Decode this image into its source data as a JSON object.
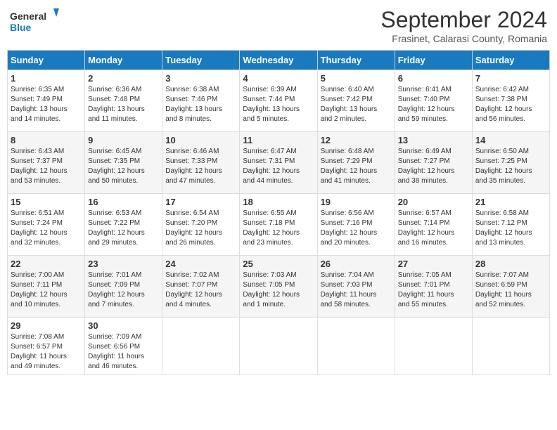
{
  "header": {
    "logo_line1": "General",
    "logo_line2": "Blue",
    "month": "September 2024",
    "location": "Frasinet, Calarasi County, Romania"
  },
  "days_of_week": [
    "Sunday",
    "Monday",
    "Tuesday",
    "Wednesday",
    "Thursday",
    "Friday",
    "Saturday"
  ],
  "weeks": [
    [
      {
        "day": "1",
        "lines": [
          "Sunrise: 6:35 AM",
          "Sunset: 7:49 PM",
          "Daylight: 13 hours",
          "and 14 minutes."
        ]
      },
      {
        "day": "2",
        "lines": [
          "Sunrise: 6:36 AM",
          "Sunset: 7:48 PM",
          "Daylight: 13 hours",
          "and 11 minutes."
        ]
      },
      {
        "day": "3",
        "lines": [
          "Sunrise: 6:38 AM",
          "Sunset: 7:46 PM",
          "Daylight: 13 hours",
          "and 8 minutes."
        ]
      },
      {
        "day": "4",
        "lines": [
          "Sunrise: 6:39 AM",
          "Sunset: 7:44 PM",
          "Daylight: 13 hours",
          "and 5 minutes."
        ]
      },
      {
        "day": "5",
        "lines": [
          "Sunrise: 6:40 AM",
          "Sunset: 7:42 PM",
          "Daylight: 13 hours",
          "and 2 minutes."
        ]
      },
      {
        "day": "6",
        "lines": [
          "Sunrise: 6:41 AM",
          "Sunset: 7:40 PM",
          "Daylight: 12 hours",
          "and 59 minutes."
        ]
      },
      {
        "day": "7",
        "lines": [
          "Sunrise: 6:42 AM",
          "Sunset: 7:38 PM",
          "Daylight: 12 hours",
          "and 56 minutes."
        ]
      }
    ],
    [
      {
        "day": "8",
        "lines": [
          "Sunrise: 6:43 AM",
          "Sunset: 7:37 PM",
          "Daylight: 12 hours",
          "and 53 minutes."
        ]
      },
      {
        "day": "9",
        "lines": [
          "Sunrise: 6:45 AM",
          "Sunset: 7:35 PM",
          "Daylight: 12 hours",
          "and 50 minutes."
        ]
      },
      {
        "day": "10",
        "lines": [
          "Sunrise: 6:46 AM",
          "Sunset: 7:33 PM",
          "Daylight: 12 hours",
          "and 47 minutes."
        ]
      },
      {
        "day": "11",
        "lines": [
          "Sunrise: 6:47 AM",
          "Sunset: 7:31 PM",
          "Daylight: 12 hours",
          "and 44 minutes."
        ]
      },
      {
        "day": "12",
        "lines": [
          "Sunrise: 6:48 AM",
          "Sunset: 7:29 PM",
          "Daylight: 12 hours",
          "and 41 minutes."
        ]
      },
      {
        "day": "13",
        "lines": [
          "Sunrise: 6:49 AM",
          "Sunset: 7:27 PM",
          "Daylight: 12 hours",
          "and 38 minutes."
        ]
      },
      {
        "day": "14",
        "lines": [
          "Sunrise: 6:50 AM",
          "Sunset: 7:25 PM",
          "Daylight: 12 hours",
          "and 35 minutes."
        ]
      }
    ],
    [
      {
        "day": "15",
        "lines": [
          "Sunrise: 6:51 AM",
          "Sunset: 7:24 PM",
          "Daylight: 12 hours",
          "and 32 minutes."
        ]
      },
      {
        "day": "16",
        "lines": [
          "Sunrise: 6:53 AM",
          "Sunset: 7:22 PM",
          "Daylight: 12 hours",
          "and 29 minutes."
        ]
      },
      {
        "day": "17",
        "lines": [
          "Sunrise: 6:54 AM",
          "Sunset: 7:20 PM",
          "Daylight: 12 hours",
          "and 26 minutes."
        ]
      },
      {
        "day": "18",
        "lines": [
          "Sunrise: 6:55 AM",
          "Sunset: 7:18 PM",
          "Daylight: 12 hours",
          "and 23 minutes."
        ]
      },
      {
        "day": "19",
        "lines": [
          "Sunrise: 6:56 AM",
          "Sunset: 7:16 PM",
          "Daylight: 12 hours",
          "and 20 minutes."
        ]
      },
      {
        "day": "20",
        "lines": [
          "Sunrise: 6:57 AM",
          "Sunset: 7:14 PM",
          "Daylight: 12 hours",
          "and 16 minutes."
        ]
      },
      {
        "day": "21",
        "lines": [
          "Sunrise: 6:58 AM",
          "Sunset: 7:12 PM",
          "Daylight: 12 hours",
          "and 13 minutes."
        ]
      }
    ],
    [
      {
        "day": "22",
        "lines": [
          "Sunrise: 7:00 AM",
          "Sunset: 7:11 PM",
          "Daylight: 12 hours",
          "and 10 minutes."
        ]
      },
      {
        "day": "23",
        "lines": [
          "Sunrise: 7:01 AM",
          "Sunset: 7:09 PM",
          "Daylight: 12 hours",
          "and 7 minutes."
        ]
      },
      {
        "day": "24",
        "lines": [
          "Sunrise: 7:02 AM",
          "Sunset: 7:07 PM",
          "Daylight: 12 hours",
          "and 4 minutes."
        ]
      },
      {
        "day": "25",
        "lines": [
          "Sunrise: 7:03 AM",
          "Sunset: 7:05 PM",
          "Daylight: 12 hours",
          "and 1 minute."
        ]
      },
      {
        "day": "26",
        "lines": [
          "Sunrise: 7:04 AM",
          "Sunset: 7:03 PM",
          "Daylight: 11 hours",
          "and 58 minutes."
        ]
      },
      {
        "day": "27",
        "lines": [
          "Sunrise: 7:05 AM",
          "Sunset: 7:01 PM",
          "Daylight: 11 hours",
          "and 55 minutes."
        ]
      },
      {
        "day": "28",
        "lines": [
          "Sunrise: 7:07 AM",
          "Sunset: 6:59 PM",
          "Daylight: 11 hours",
          "and 52 minutes."
        ]
      }
    ],
    [
      {
        "day": "29",
        "lines": [
          "Sunrise: 7:08 AM",
          "Sunset: 6:57 PM",
          "Daylight: 11 hours",
          "and 49 minutes."
        ]
      },
      {
        "day": "30",
        "lines": [
          "Sunrise: 7:09 AM",
          "Sunset: 6:56 PM",
          "Daylight: 11 hours",
          "and 46 minutes."
        ]
      },
      {
        "day": "",
        "lines": []
      },
      {
        "day": "",
        "lines": []
      },
      {
        "day": "",
        "lines": []
      },
      {
        "day": "",
        "lines": []
      },
      {
        "day": "",
        "lines": []
      }
    ]
  ]
}
